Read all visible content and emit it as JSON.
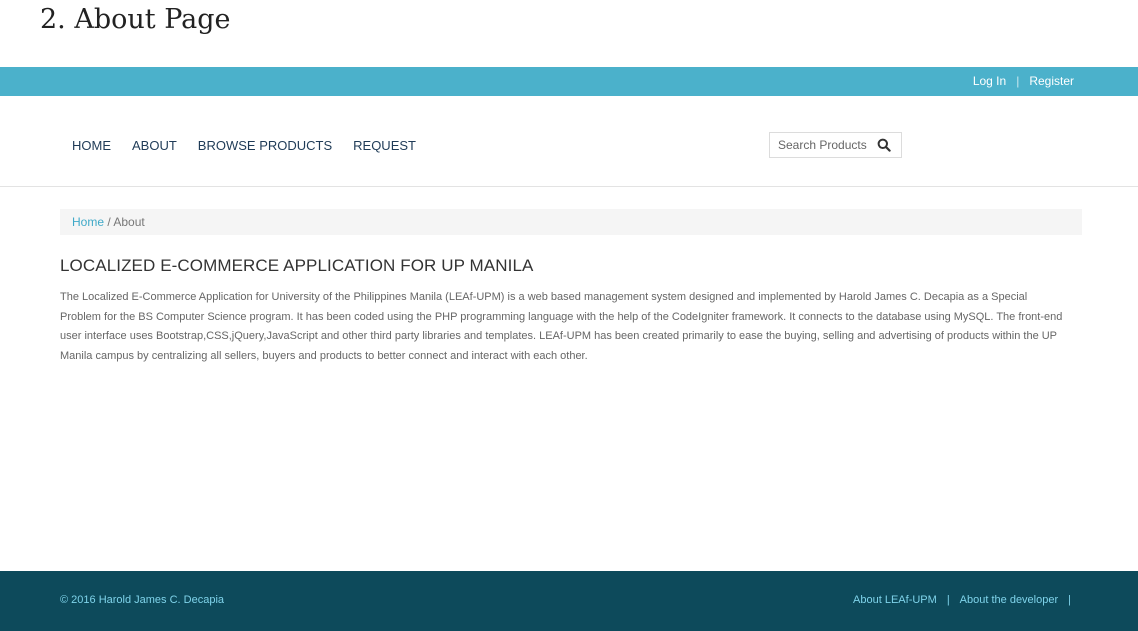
{
  "caption": "2. About Page",
  "topbar": {
    "login_label": "Log In",
    "separator": "|",
    "register_label": "Register"
  },
  "nav": {
    "items": [
      {
        "label": "HOME"
      },
      {
        "label": "ABOUT"
      },
      {
        "label": "BROWSE PRODUCTS"
      },
      {
        "label": "REQUEST"
      }
    ]
  },
  "search": {
    "placeholder": "Search Products"
  },
  "breadcrumb": {
    "home": "Home",
    "current": " / About"
  },
  "main": {
    "title": "LOCALIZED E-COMMERCE APPLICATION FOR UP MANILA",
    "description": "The Localized E-Commerce Application for University of the Philippines Manila (LEAf-UPM) is a web based management system designed and implemented by Harold James C. Decapia as a Special Problem for the BS Computer Science program. It has been coded using the PHP programming language with the help of the CodeIgniter framework. It connects to the database using MySQL. The front-end user interface uses Bootstrap,CSS,jQuery,JavaScript and other third party libraries and templates. LEAf-UPM has been created primarily to ease the buying, selling and advertising of products within the UP Manila campus by centralizing all sellers, buyers and products to better connect and interact with each other."
  },
  "footer": {
    "copyright": "© 2016 Harold James C. Decapia",
    "link_about": "About LEAf-UPM",
    "separator": "|",
    "link_developer": "About the developer"
  },
  "colors": {
    "topbar": "#4bb1cb",
    "footer": "#0d4a5b",
    "link": "#3fa9c8"
  }
}
